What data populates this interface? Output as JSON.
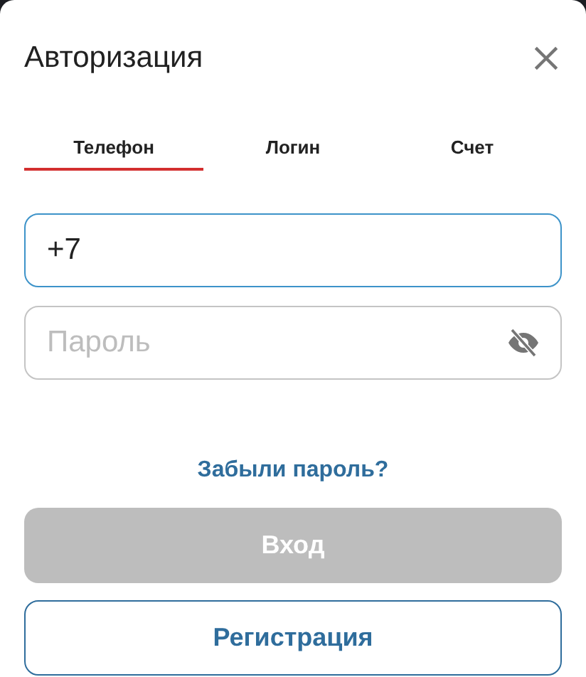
{
  "dialog": {
    "title": "Авторизация"
  },
  "tabs": [
    {
      "label": "Телефон",
      "selected": true
    },
    {
      "label": "Логин",
      "selected": false
    },
    {
      "label": "Счет",
      "selected": false
    }
  ],
  "phone_field": {
    "value": "+7",
    "focused": true
  },
  "password_field": {
    "placeholder": "Пароль"
  },
  "forgot_link": "Забыли пароль?",
  "login_button": {
    "label": "Вход",
    "disabled": true
  },
  "register_button": {
    "label": "Регистрация"
  }
}
